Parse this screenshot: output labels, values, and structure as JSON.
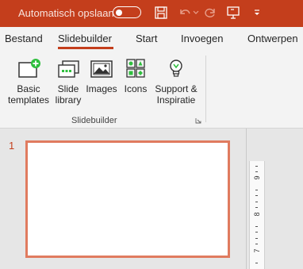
{
  "titlebar": {
    "autosave_label": "Automatisch opslaan",
    "autosave_state": "off",
    "icons": [
      "save-icon",
      "undo-icon",
      "undo-dropdown-icon",
      "redo-icon",
      "present-icon",
      "customize-toolbar-icon"
    ]
  },
  "tabs": [
    {
      "label": "Bestand"
    },
    {
      "label": "Slidebuilder",
      "active": true
    },
    {
      "label": "Start"
    },
    {
      "label": "Invoegen"
    },
    {
      "label": "Ontwerpen"
    }
  ],
  "ribbon": {
    "group_label": "Slidebuilder",
    "buttons": [
      {
        "line1": "Basic",
        "line2": "templates",
        "icon": "basic-templates-icon"
      },
      {
        "line1": "Slide",
        "line2": "library",
        "icon": "slide-library-icon"
      },
      {
        "line1": "Images",
        "line2": "",
        "icon": "images-icon"
      },
      {
        "line1": "Icons",
        "line2": "",
        "icon": "icons-icon"
      },
      {
        "line1": "Support &",
        "line2": "Inspiratie",
        "icon": "lightbulb-icon"
      }
    ]
  },
  "slides": {
    "number": "1"
  },
  "ruler": {
    "labels": [
      "9",
      "8",
      "7"
    ]
  },
  "colors": {
    "accent": "#c43e1c",
    "slide_border": "#e07b5f",
    "icon_green": "#2fbf3e"
  }
}
